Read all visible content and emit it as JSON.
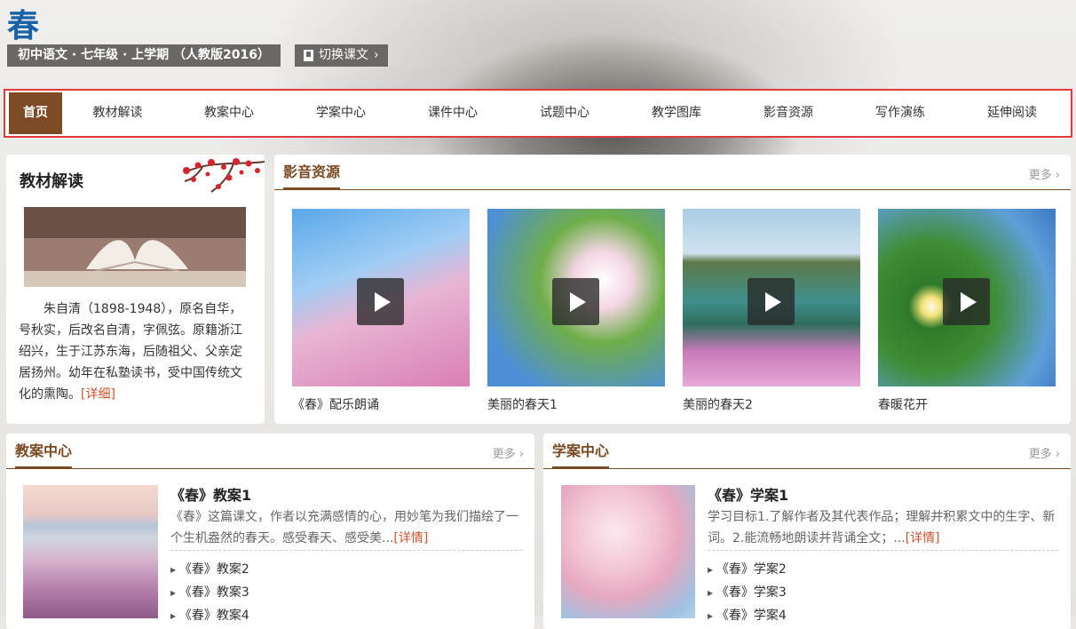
{
  "header": {
    "title": "春",
    "breadcrumb": "初中语文 · 七年级 · 上学期 （人教版2016）",
    "switch_label": "切换课文",
    "switch_arrow": "›"
  },
  "nav": {
    "items": [
      {
        "label": "首页",
        "active": true
      },
      {
        "label": "教材解读"
      },
      {
        "label": "教案中心"
      },
      {
        "label": "学案中心"
      },
      {
        "label": "课件中心"
      },
      {
        "label": "试题中心"
      },
      {
        "label": "教学图库"
      },
      {
        "label": "影音资源"
      },
      {
        "label": "写作演练"
      },
      {
        "label": "延伸阅读"
      }
    ]
  },
  "textbook": {
    "title": "教材解读",
    "intro": "朱自清（1898-1948），原名自华，号秋实，后改名自清，字佩弦。原籍浙江绍兴，生于江苏东海，后随祖父、父亲定居扬州。幼年在私塾读书，受中国传统文化的熏陶。",
    "detail": "[详细]"
  },
  "media": {
    "title": "影音资源",
    "more": "更多 ›",
    "videos": [
      {
        "caption": "《春》配乐朗诵"
      },
      {
        "caption": "美丽的春天1"
      },
      {
        "caption": "美丽的春天2"
      },
      {
        "caption": "春暖花开"
      }
    ]
  },
  "lesson_plans": {
    "title": "教案中心",
    "more": "更多 ›",
    "featured_title": "《春》教案1",
    "featured_desc": "《春》这篇课文，作者以充满感情的心，用妙笔为我们描绘了一个生机盎然的春天。感受春天、感受美...",
    "detail": "[详情]",
    "items": [
      "《春》教案2",
      "《春》教案3",
      "《春》教案4"
    ]
  },
  "study_plans": {
    "title": "学案中心",
    "more": "更多 ›",
    "featured_title": "《春》学案1",
    "featured_desc": "学习目标1.了解作者及其代表作品；理解并积累文中的生字、新词。2.能流畅地朗读并背诵全文；...",
    "detail": "[详情]",
    "items": [
      "《春》学案2",
      "《春》学案3",
      "《春》学案4"
    ]
  },
  "colors": {
    "accent": "#7a4a22",
    "nav_border": "#e03a3e",
    "title_blue": "#1b63a8",
    "link": "#d2502e"
  }
}
